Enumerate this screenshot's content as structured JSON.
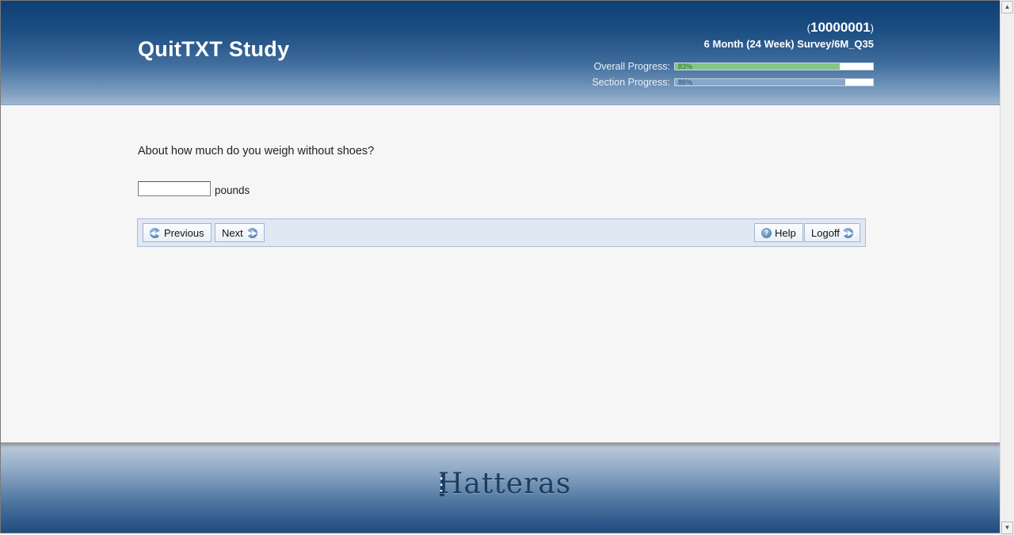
{
  "header": {
    "app_title": "QuitTXT Study",
    "participant_open": "(",
    "participant_id": "10000001",
    "participant_close": ")",
    "survey_path": "6 Month (24 Week) Survey/6M_Q35",
    "overall_progress": {
      "label": "Overall Progress:",
      "value": 83,
      "pct_text": "83%"
    },
    "section_progress": {
      "label": "Section Progress:",
      "value": 86,
      "pct_text": "86%"
    }
  },
  "question": {
    "text": "About how much do you weigh without shoes?",
    "input_value": "",
    "unit": "pounds"
  },
  "nav": {
    "previous_label": "Previous",
    "next_label": "Next",
    "help_label": "Help",
    "logoff_label": "Logoff"
  },
  "footer": {
    "logo_text": "Hatteras"
  },
  "colors": {
    "header_dark": "#0f3f72",
    "overall_bar": "#84c683",
    "section_bar": "#89a8c8",
    "nav_bg": "#dfe8f3"
  },
  "icons": [
    "rewind-icon",
    "fast-forward-icon",
    "help-icon"
  ]
}
